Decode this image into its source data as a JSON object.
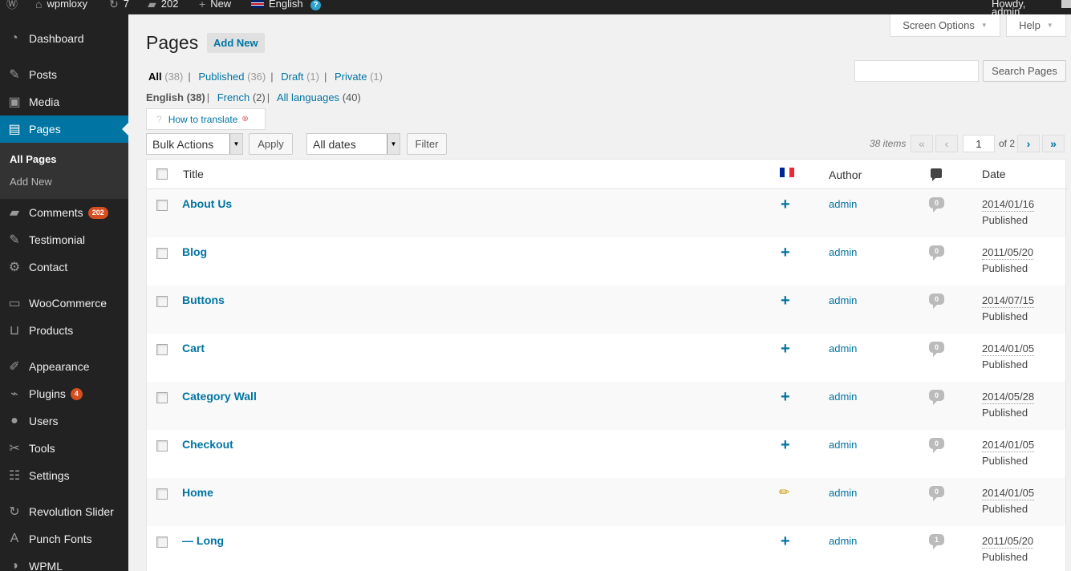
{
  "adminbar": {
    "site_name": "wpmloxy",
    "updates_count": "7",
    "comments_count": "202",
    "new_label": "New",
    "language": "English",
    "howdy": "Howdy, admin"
  },
  "sidebar": {
    "items": [
      {
        "label": "Dashboard",
        "icon": "dashboard-icon"
      },
      {
        "label": "Posts",
        "icon": "pin-icon"
      },
      {
        "label": "Media",
        "icon": "media-icon"
      },
      {
        "label": "Pages",
        "icon": "page-icon"
      },
      {
        "label": "Comments",
        "icon": "comment-icon",
        "badge": "202"
      },
      {
        "label": "Testimonial",
        "icon": "pin-icon"
      },
      {
        "label": "Contact",
        "icon": "gear-icon"
      },
      {
        "label": "WooCommerce",
        "icon": "woo-icon"
      },
      {
        "label": "Products",
        "icon": "cart-icon"
      },
      {
        "label": "Appearance",
        "icon": "brush-icon"
      },
      {
        "label": "Plugins",
        "icon": "plug-icon",
        "badge": "4"
      },
      {
        "label": "Users",
        "icon": "user-icon"
      },
      {
        "label": "Tools",
        "icon": "wrench-icon"
      },
      {
        "label": "Settings",
        "icon": "sliders-icon"
      },
      {
        "label": "Revolution Slider",
        "icon": "refresh-icon"
      },
      {
        "label": "Punch Fonts",
        "icon": "font-icon"
      },
      {
        "label": "WPML",
        "icon": "wpml-icon"
      }
    ],
    "submenu": [
      "All Pages",
      "Add New"
    ]
  },
  "header": {
    "screen_options": "Screen Options",
    "help": "Help",
    "title": "Pages",
    "add_new": "Add New"
  },
  "filters": {
    "status": [
      {
        "label": "All",
        "count": "(38)"
      },
      {
        "label": "Published",
        "count": "(36)"
      },
      {
        "label": "Draft",
        "count": "(1)"
      },
      {
        "label": "Private",
        "count": "(1)"
      }
    ],
    "languages": [
      {
        "label": "English",
        "count": "(38)"
      },
      {
        "label": "French",
        "count": "(2)"
      },
      {
        "label": "All languages",
        "count": "(40)"
      }
    ],
    "how_to_translate": "How to translate"
  },
  "search": {
    "button": "Search Pages"
  },
  "tablenav": {
    "bulk_actions": "Bulk Actions",
    "apply": "Apply",
    "dates": "All dates",
    "filter": "Filter",
    "items": "38 items",
    "page": "1",
    "of_pages": "of 2"
  },
  "table": {
    "columns": {
      "title": "Title",
      "author": "Author",
      "date": "Date"
    },
    "rows": [
      {
        "title": "About Us",
        "author": "admin",
        "comments": "0",
        "date": "2014/01/16",
        "status": "Published",
        "translation": "add"
      },
      {
        "title": "Blog",
        "author": "admin",
        "comments": "0",
        "date": "2011/05/20",
        "status": "Published",
        "translation": "add"
      },
      {
        "title": "Buttons",
        "author": "admin",
        "comments": "0",
        "date": "2014/07/15",
        "status": "Published",
        "translation": "add"
      },
      {
        "title": "Cart",
        "author": "admin",
        "comments": "0",
        "date": "2014/01/05",
        "status": "Published",
        "translation": "add"
      },
      {
        "title": "Category Wall",
        "author": "admin",
        "comments": "0",
        "date": "2014/05/28",
        "status": "Published",
        "translation": "add"
      },
      {
        "title": "Checkout",
        "author": "admin",
        "comments": "0",
        "date": "2014/01/05",
        "status": "Published",
        "translation": "add"
      },
      {
        "title": "Home",
        "author": "admin",
        "comments": "0",
        "date": "2014/01/05",
        "status": "Published",
        "translation": "edit"
      },
      {
        "title": "— Long",
        "author": "admin",
        "comments": "1",
        "date": "2011/05/20",
        "status": "Published",
        "translation": "add"
      }
    ]
  }
}
